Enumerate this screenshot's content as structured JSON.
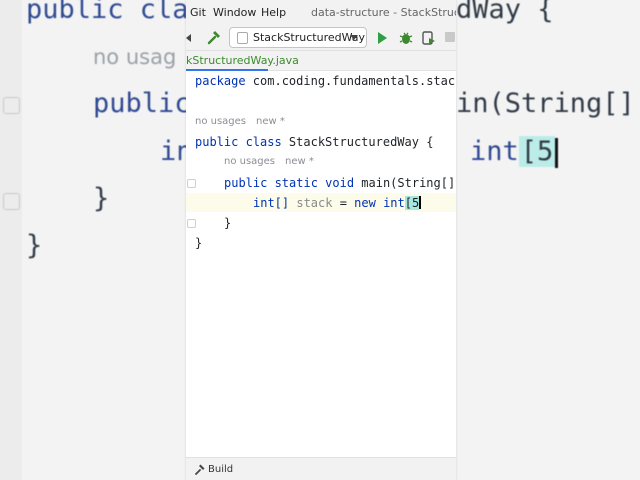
{
  "background": {
    "lines": [
      "public class",
      "public",
      "int",
      "}",
      "}"
    ],
    "hint": "no usag",
    "right_line1": "dWay {",
    "right_line2": "in(String[]",
    "right_line3_pre": "int",
    "right_line3_bracket": "[5",
    "bracket_color": "#b7ece7"
  },
  "menubar": {
    "items": [
      "Git",
      "Window",
      "Help"
    ],
    "window_title": "data-structure - StackStructured"
  },
  "toolbar": {
    "run_config": "StackStructuredWay",
    "run_color": "#2ea043",
    "build_color": "#3d8a2e"
  },
  "tabs": {
    "active": "kStructuredWay.java",
    "active_color": "#3d8a2e"
  },
  "editor": {
    "line_package": "package com.coding.fundamentals.stac",
    "hint1": {
      "usages": "no usages",
      "author": "new *"
    },
    "line_class_kw": "public class",
    "line_class_rest": " StackStructuredWay {",
    "hint2": {
      "usages": "no usages",
      "author": "new *"
    },
    "line_main_kw": "public static void",
    "line_main_rest": " main(String[]",
    "line_stmt_type": "int[]",
    "line_stmt_var": "stack",
    "line_stmt_eq": " = ",
    "line_stmt_new": "new",
    "line_stmt_int": " int",
    "line_stmt_bracket": "[5",
    "line_close_inner": "}",
    "line_close_outer": "}"
  },
  "statusbar": {
    "label": "Build"
  }
}
